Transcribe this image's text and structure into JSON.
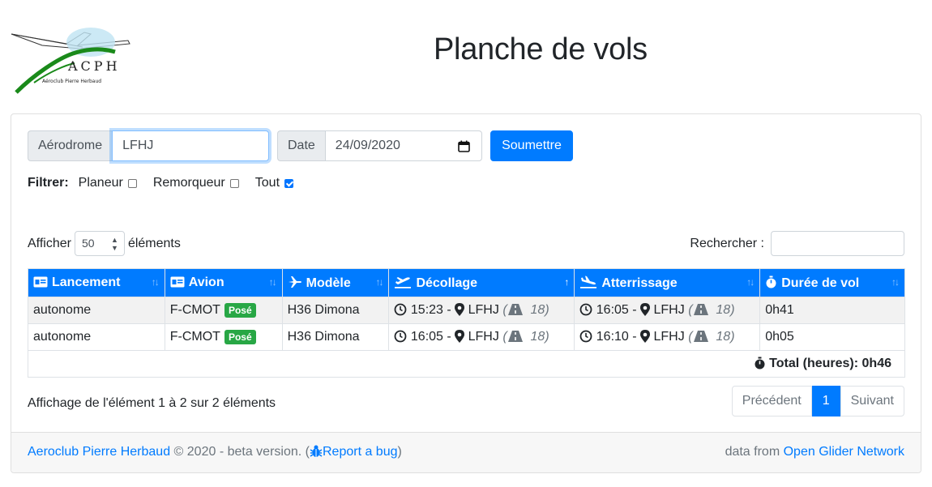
{
  "logo": {
    "text": "ACPH",
    "subtitle": "Aéroclub Pierre Herbaud"
  },
  "title": "Planche de vols",
  "form": {
    "aerodrome_label": "Aérodrome",
    "aerodrome_value": "LFHJ",
    "date_label": "Date",
    "date_value": "24/09/2020",
    "submit_label": "Soumettre"
  },
  "filters": {
    "label": "Filtrer:",
    "options": [
      {
        "label": "Planeur",
        "checked": false
      },
      {
        "label": "Remorqueur",
        "checked": false
      },
      {
        "label": "Tout",
        "checked": true
      }
    ]
  },
  "table_controls": {
    "show_label": "Afficher",
    "page_length": "50",
    "entries_label": "éléments",
    "search_label": "Rechercher :",
    "search_value": ""
  },
  "table": {
    "columns": [
      {
        "label": "Lancement",
        "icon": "id-card-icon"
      },
      {
        "label": "Avion",
        "icon": "id-card-icon"
      },
      {
        "label": "Modèle",
        "icon": "plane-icon"
      },
      {
        "label": "Décollage",
        "icon": "plane-departure-icon",
        "sorted": "asc"
      },
      {
        "label": "Atterrissage",
        "icon": "plane-arrival-icon"
      },
      {
        "label": "Durée de vol",
        "icon": "stopwatch-icon"
      }
    ],
    "rows": [
      {
        "launch": "autonome",
        "aircraft": "F-CMOT",
        "badge": "Posé",
        "model": "H36 Dimona",
        "takeoff_time": "15:23",
        "takeoff_field": "LFHJ",
        "takeoff_runway": "18",
        "landing_time": "16:05",
        "landing_field": "LFHJ",
        "landing_runway": "18",
        "duration": "0h41"
      },
      {
        "launch": "autonome",
        "aircraft": "F-CMOT",
        "badge": "Posé",
        "model": "H36 Dimona",
        "takeoff_time": "16:05",
        "takeoff_field": "LFHJ",
        "takeoff_runway": "18",
        "landing_time": "16:10",
        "landing_field": "LFHJ",
        "landing_runway": "18",
        "duration": "0h05"
      }
    ],
    "total_label": "Total (heures): 0h46"
  },
  "info_text": "Affichage de l'élément 1 à 2 sur 2 éléments",
  "pagination": {
    "prev": "Précédent",
    "current": "1",
    "next": "Suivant"
  },
  "footer": {
    "club_link": "Aeroclub Pierre Herbaud",
    "copyright": "© 2020 - beta version. (",
    "bug_link": "Report a bug",
    "close_paren": ")",
    "data_from": "data from",
    "ogn_link": "Open Glider Network"
  },
  "colors": {
    "primary": "#007bff",
    "success": "#28a745",
    "header_bg": "#007bff"
  }
}
